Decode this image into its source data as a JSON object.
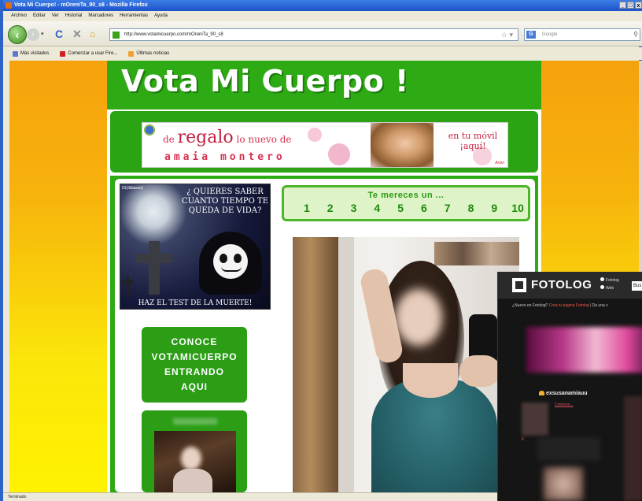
{
  "browser": {
    "title": "Vota Mi Cuerpo! - mOreniTa_90_s8 - Mozilla Firefox",
    "window_buttons": [
      "_",
      "□",
      "x"
    ],
    "menu": [
      "Archivo",
      "Editar",
      "Ver",
      "Historial",
      "Marcadores",
      "Herramientas",
      "Ayuda"
    ],
    "url": "http://www.votamicuerpo.com/mOreniTa_90_s8",
    "search_placeholder": "Google",
    "bookmarks": [
      "Más visitados",
      "Comenzar a usar Fire...",
      "Últimas noticias"
    ],
    "status": "Terminado"
  },
  "site": {
    "title": "Vota Mi Cuerpo !",
    "banner": {
      "line1_small": "de",
      "line1_big": "regalo",
      "line1_rest": "lo nuevo de",
      "line2": "amaia montero",
      "right_line1": "en tu móvil",
      "right_line2": "¡aquí!",
      "brand": "Arion"
    },
    "death_ad": {
      "tag": "01(3&lasso)",
      "question": "¿ QUIERES SABER CUANTO TIEMPO TE QUEDA DE VIDA?",
      "cta": "HAZ EL TEST DE LA MUERTE!"
    },
    "rating": {
      "label": "Te mereces un ...",
      "values": [
        "1",
        "2",
        "3",
        "4",
        "5",
        "6",
        "7",
        "8",
        "9",
        "10"
      ]
    },
    "conoce": [
      "CONOCE",
      "VOTAMICUERPO",
      "ENTRANDO",
      "AQUI"
    ]
  },
  "fotolog": {
    "logo": "FOTOLOG",
    "radio1": "Fotolog",
    "radio2": "Web",
    "search": "Bus",
    "links_prefix": "¿Nuevo en Fotolog?",
    "links_create": "Crea tu página Fotolog",
    "links_more": "| Da una v",
    "username": "exsusanamiauu",
    "sub_link": "Cotorreo...",
    "dot": "E"
  },
  "colors": {
    "site_green": "#2eaa15",
    "bg_orange": "#f5a20c",
    "bg_yellow": "#fff200"
  }
}
